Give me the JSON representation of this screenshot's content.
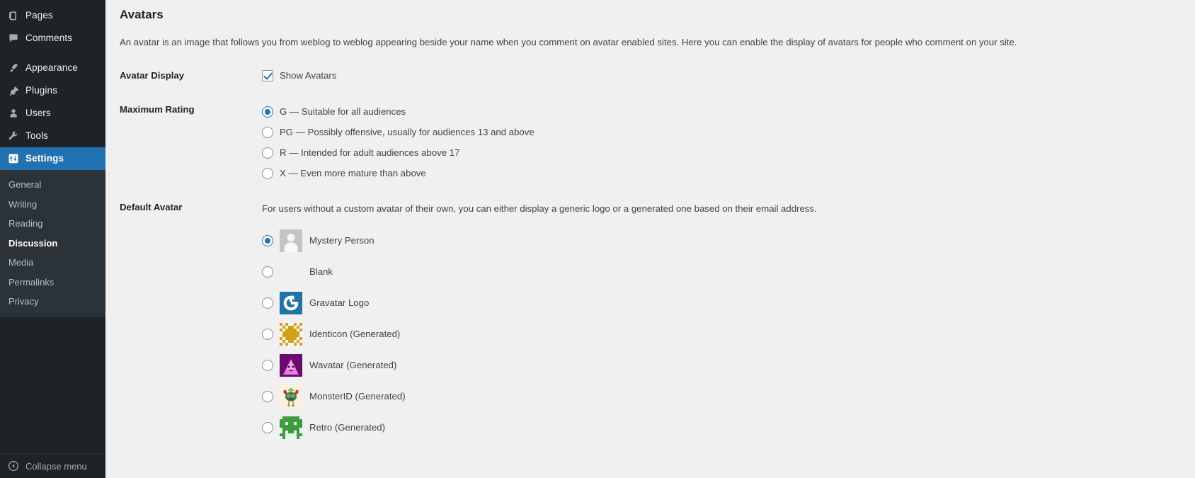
{
  "sidebar": {
    "items": [
      {
        "label": "Pages",
        "icon": "pages-icon",
        "current": false
      },
      {
        "label": "Comments",
        "icon": "comments-icon",
        "current": false
      },
      {
        "label": "Appearance",
        "icon": "appearance-icon",
        "current": false
      },
      {
        "label": "Plugins",
        "icon": "plugins-icon",
        "current": false
      },
      {
        "label": "Users",
        "icon": "users-icon",
        "current": false
      },
      {
        "label": "Tools",
        "icon": "tools-icon",
        "current": false
      },
      {
        "label": "Settings",
        "icon": "settings-icon",
        "current": true
      }
    ],
    "submenu": [
      {
        "label": "General",
        "active": false
      },
      {
        "label": "Writing",
        "active": false
      },
      {
        "label": "Reading",
        "active": false
      },
      {
        "label": "Discussion",
        "active": true
      },
      {
        "label": "Media",
        "active": false
      },
      {
        "label": "Permalinks",
        "active": false
      },
      {
        "label": "Privacy",
        "active": false
      }
    ],
    "collapse": {
      "label": "Collapse menu",
      "icon": "collapse-left-icon"
    },
    "colors": {
      "background": "#1d2327",
      "submenu_background": "#2c3338",
      "current_highlight": "#2271b1",
      "text": "#f0f0f1",
      "muted_text": "#a7aaad"
    }
  },
  "main": {
    "title": "Avatars",
    "description": "An avatar is an image that follows you from weblog to weblog appearing beside your name when you comment on avatar enabled sites. Here you can enable the display of avatars for people who comment on your site.",
    "avatar_display": {
      "label": "Avatar Display",
      "checkbox_label": "Show Avatars",
      "checked": true
    },
    "maximum_rating": {
      "label": "Maximum Rating",
      "selected": "G",
      "options": [
        {
          "value": "G",
          "label": "G — Suitable for all audiences",
          "checked": true
        },
        {
          "value": "PG",
          "label": "PG — Possibly offensive, usually for audiences 13 and above",
          "checked": false
        },
        {
          "value": "R",
          "label": "R — Intended for adult audiences above 17",
          "checked": false
        },
        {
          "value": "X",
          "label": "X — Even more mature than above",
          "checked": false
        }
      ]
    },
    "default_avatar": {
      "label": "Default Avatar",
      "intro": "For users without a custom avatar of their own, you can either display a generic logo or a generated one based on their email address.",
      "selected": "Mystery Person",
      "options": [
        {
          "label": "Mystery Person",
          "icon": "mystery-person-avatar",
          "checked": true
        },
        {
          "label": "Blank",
          "icon": "blank-avatar",
          "checked": false
        },
        {
          "label": "Gravatar Logo",
          "icon": "gravatar-logo-avatar",
          "checked": false
        },
        {
          "label": "Identicon (Generated)",
          "icon": "identicon-avatar",
          "checked": false
        },
        {
          "label": "Wavatar (Generated)",
          "icon": "wavatar-avatar",
          "checked": false
        },
        {
          "label": "MonsterID (Generated)",
          "icon": "monsterid-avatar",
          "checked": false
        },
        {
          "label": "Retro (Generated)",
          "icon": "retro-avatar",
          "checked": false
        }
      ]
    },
    "colors": {
      "background": "#f0f0f1",
      "heading": "#1d2327",
      "body_text": "#3c434a",
      "accent": "#2271b1",
      "gravatar_blue": "#1e73a8",
      "identicon_gold": "#d2a017",
      "wavatar_purple": "#6b0b6b",
      "monster_green": "#3f7a42",
      "retro_green": "#3e9b3e"
    }
  }
}
